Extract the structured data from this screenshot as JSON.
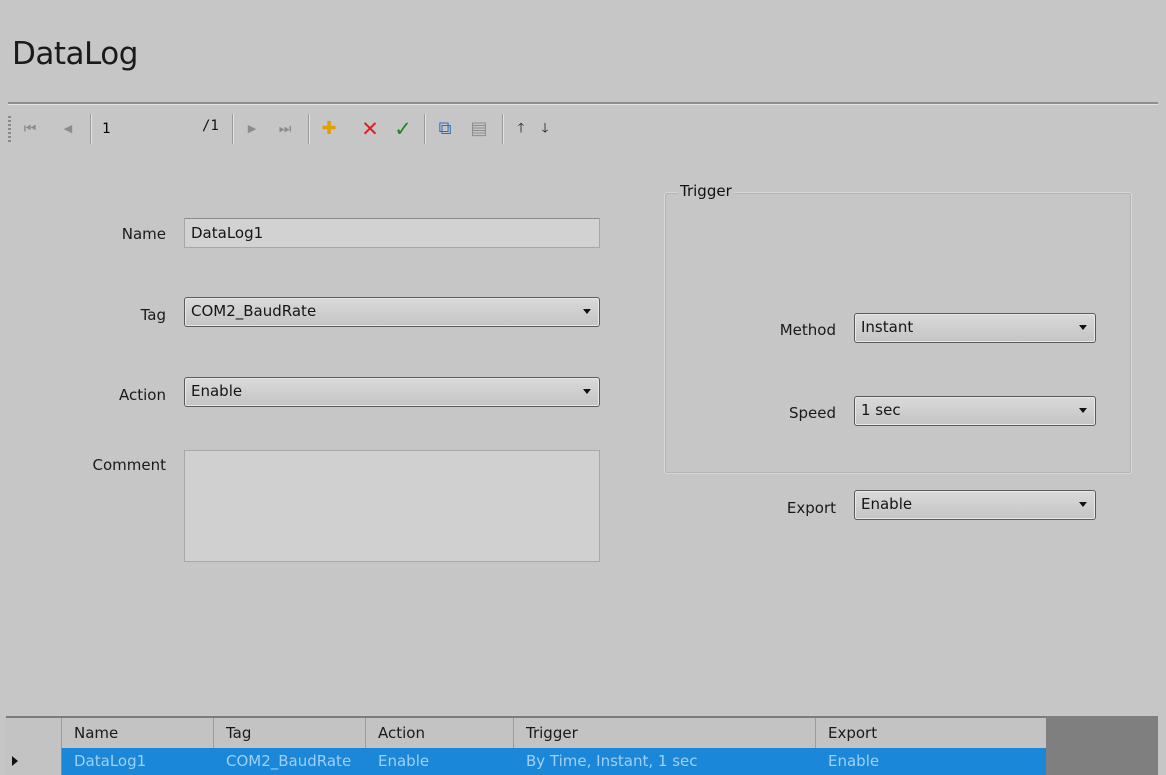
{
  "app": {
    "title": "DataLog"
  },
  "toolbar": {
    "first_icon": "⏮",
    "prev_icon": "◀",
    "page_value": "1",
    "page_total": "/1",
    "next_icon": "▶",
    "last_icon": "⏭",
    "add_icon": "✚",
    "delete_icon": "✕",
    "apply_icon": "✓",
    "copy_icon": "⧉",
    "paste_icon": "▤",
    "move_up_icon": "🡑",
    "move_down_icon": "🡓",
    "colors": {
      "add": "#e0a000",
      "delete": "#e02020",
      "apply": "#1a8a1a",
      "copy": "#2a6fc0"
    }
  },
  "form": {
    "name_label": "Name",
    "name_value": "DataLog1",
    "tag_label": "Tag",
    "tag_value": "COM2_BaudRate",
    "action_label": "Action",
    "action_value": "Enable",
    "comment_label": "Comment",
    "comment_value": ""
  },
  "trigger": {
    "group_title": "Trigger",
    "method_label": "Method",
    "method_value": "Instant",
    "speed_label": "Speed",
    "speed_value": "1 sec"
  },
  "export": {
    "label": "Export",
    "value": "Enable"
  },
  "grid": {
    "columns": [
      "Name",
      "Tag",
      "Action",
      "Trigger",
      "Export"
    ],
    "rows": [
      [
        "DataLog1",
        "COM2_BaudRate",
        "Enable",
        "By Time, Instant, 1 sec",
        "Enable"
      ]
    ],
    "selection_color": "#1a87d8"
  }
}
